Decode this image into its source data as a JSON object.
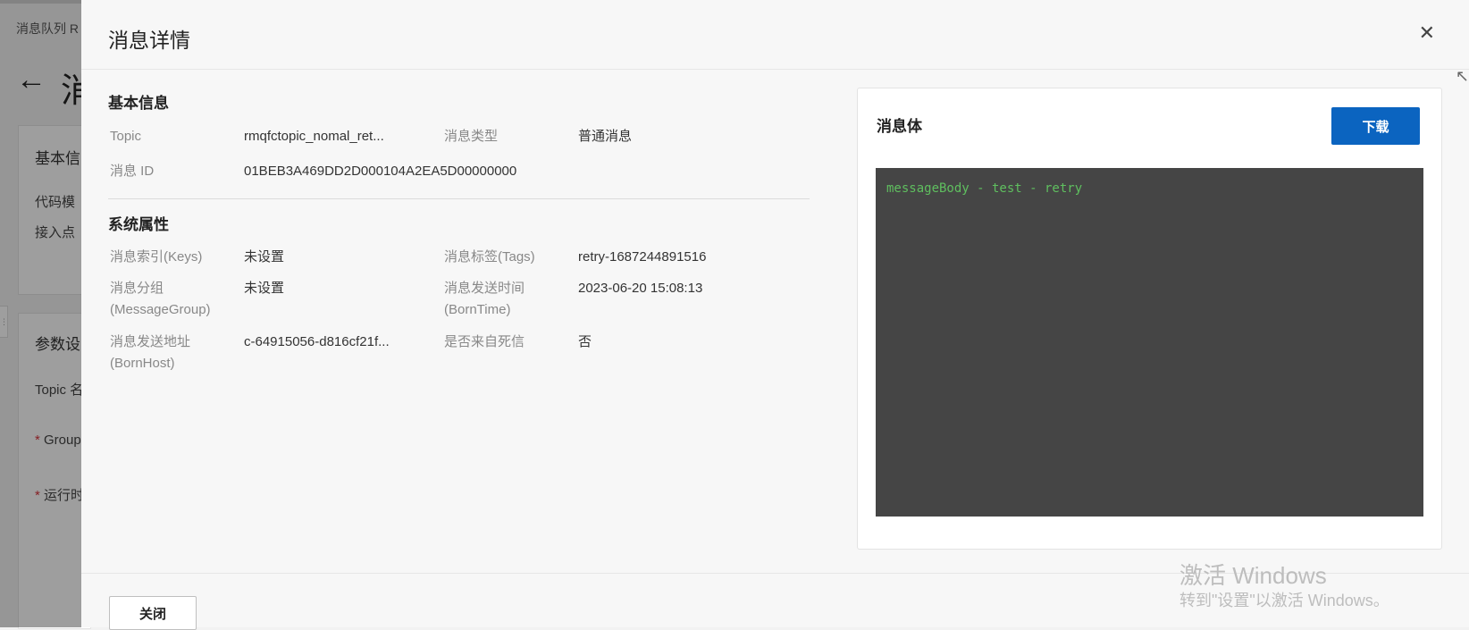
{
  "background": {
    "breadcrumb": "消息队列 R",
    "back_icon": "←",
    "page_title": "消",
    "card1": {
      "heading": "基本信",
      "row1": "代码模",
      "row2": "接入点"
    },
    "card2": {
      "heading": "参数设",
      "row1": "Topic 名",
      "row2": "Group",
      "row3": "运行时",
      "required_mark": "*"
    },
    "handle_glyph": "⋮"
  },
  "drawer": {
    "title": "消息详情",
    "close_icon": "✕",
    "cursor_glyph": "↖",
    "basic_info": {
      "heading": "基本信息",
      "topic_label": "Topic",
      "topic_value": "rmqfctopic_nomal_ret...",
      "type_label": "消息类型",
      "type_value": "普通消息",
      "id_label": "消息 ID",
      "id_value": "01BEB3A469DD2D000104A2EA5D00000000"
    },
    "system_props": {
      "heading": "系统属性",
      "keys_label": "消息索引(Keys)",
      "keys_value": "未设置",
      "tags_label": "消息标签(Tags)",
      "tags_value": "retry-1687244891516",
      "group_label_1": "消息分组",
      "group_label_2": "(MessageGroup)",
      "group_value": "未设置",
      "borntime_label_1": "消息发送时间",
      "borntime_label_2": "(BornTime)",
      "borntime_value": "2023-06-20 15:08:13",
      "bornhost_label_1": "消息发送地址",
      "bornhost_label_2": "(BornHost)",
      "bornhost_value": "c-64915056-d816cf21f...",
      "dlq_label": "是否来自死信",
      "dlq_value": "否"
    },
    "message_body": {
      "heading": "消息体",
      "download_label": "下载",
      "content": "messageBody - test - retry"
    },
    "footer": {
      "close_label": "关闭"
    }
  },
  "watermark": {
    "line1": "激活 Windows",
    "line2": "转到\"设置\"以激活 Windows。"
  },
  "colors": {
    "primary": "#0b64c0",
    "code_bg": "#454545",
    "code_text": "#5fbf5f",
    "required": "#d9363e"
  }
}
